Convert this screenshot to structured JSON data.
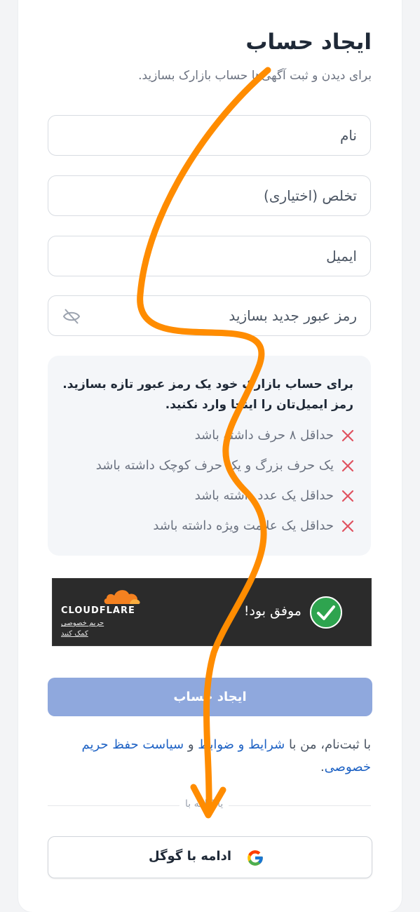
{
  "header": {
    "title": "ایجاد حساب",
    "subtitle": "برای دیدن و ثبت آگهی‌ها حساب بازارک بسازید."
  },
  "form": {
    "name_placeholder": "نام",
    "nickname_placeholder": "تخلص (اختیاری)",
    "email_placeholder": "ایمیل",
    "password_placeholder": "رمز عبور جدید بسازید"
  },
  "password_rules": {
    "intro_line1": "برای حساب بازارک خود یک رمز عبور تازه بسازید.",
    "intro_line2": "رمز ایمیل‌تان را اینجا وارد نکنید.",
    "items": [
      "حداقل ۸ حرف داشته باشد",
      "یک حرف بزرگ و یک حرف کوچک داشته باشد",
      "حداقل یک عدد داشته باشد",
      "حداقل یک علامت ویژه داشته باشد"
    ]
  },
  "captcha": {
    "status": "موفق بود!",
    "brand": "CLOUDFLARE",
    "privacy_link": "حریم خصوصی",
    "help_link": "کمک کنید"
  },
  "submit_label": "ایجاد حساب",
  "terms": {
    "prefix": "با ثبت‌نام، من با",
    "terms_link": "شرایط و ضوابط",
    "and": "و",
    "privacy_link": "سیاست حفظ حریم خصوصی",
    "suffix": "."
  },
  "divider_label": "یا ادامه با",
  "google_button_label": "ادامه با گوگل",
  "colors": {
    "primary_disabled": "#8fa8dd",
    "link": "#1e62c4",
    "error_x": "#e05260",
    "success_green": "#2ea44f",
    "annotation_arrow": "#ff8c00"
  }
}
